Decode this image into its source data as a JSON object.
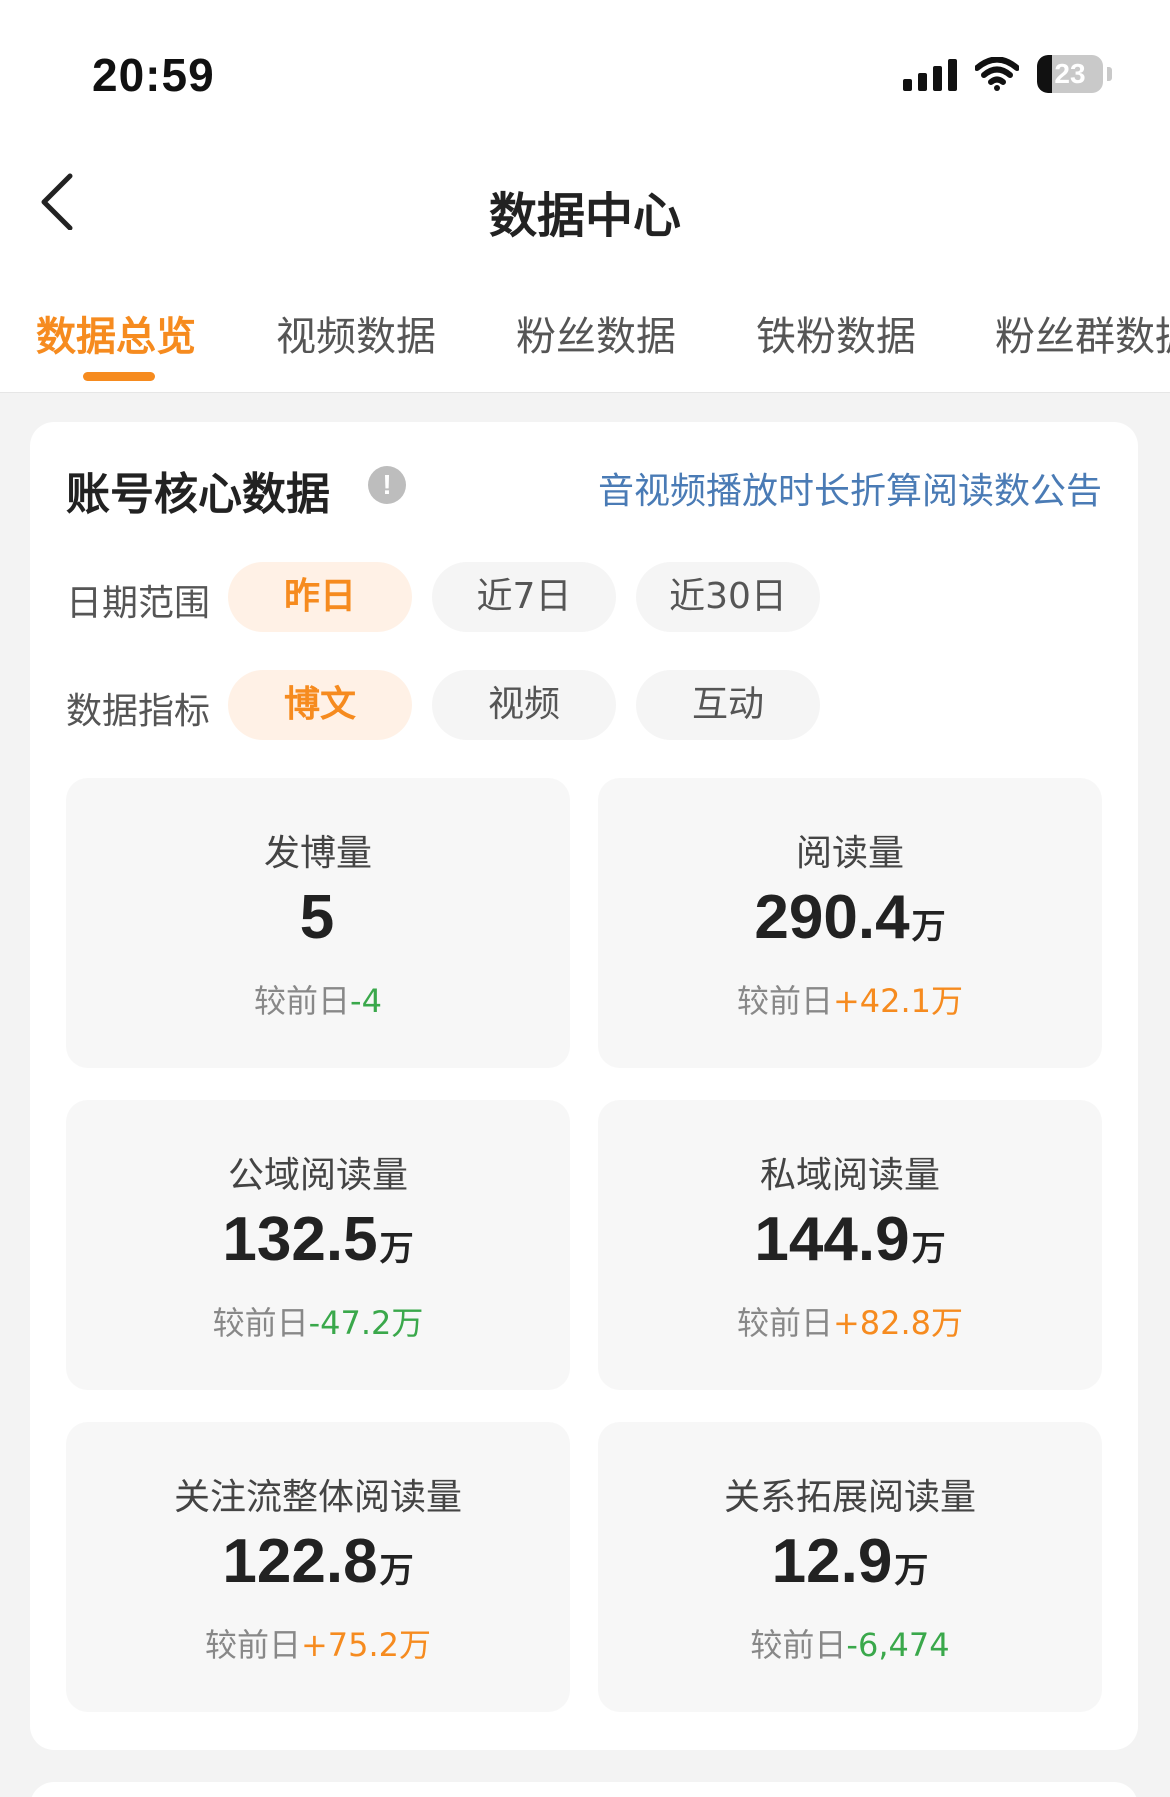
{
  "status_bar": {
    "time": "20:59",
    "battery_level": "23",
    "icons": [
      "signal-icon",
      "wifi-icon",
      "battery-icon"
    ]
  },
  "header": {
    "title": "数据中心",
    "back_icon": "chevron-left-icon"
  },
  "tabs": [
    {
      "label": "数据总览",
      "active": true
    },
    {
      "label": "视频数据",
      "active": false
    },
    {
      "label": "粉丝数据",
      "active": false
    },
    {
      "label": "铁粉数据",
      "active": false
    },
    {
      "label": "粉丝群数据",
      "active": false
    }
  ],
  "core": {
    "title": "账号核心数据",
    "info_icon": "info-icon",
    "notice_link": "音视频播放时长折算阅读数公告",
    "date_range": {
      "label": "日期范围",
      "options": [
        {
          "label": "昨日",
          "active": true
        },
        {
          "label": "近7日",
          "active": false
        },
        {
          "label": "近30日",
          "active": false
        }
      ]
    },
    "metric_type": {
      "label": "数据指标",
      "options": [
        {
          "label": "博文",
          "active": true
        },
        {
          "label": "视频",
          "active": false
        },
        {
          "label": "互动",
          "active": false
        }
      ]
    },
    "compare_prefix": "较前日",
    "metrics": [
      {
        "label": "发博量",
        "value": "5",
        "unit": "",
        "delta": "-4",
        "trend": "down"
      },
      {
        "label": "阅读量",
        "value": "290.4",
        "unit": "万",
        "delta": "+42.1万",
        "trend": "up"
      },
      {
        "label": "公域阅读量",
        "value": "132.5",
        "unit": "万",
        "delta": "-47.2万",
        "trend": "down"
      },
      {
        "label": "私域阅读量",
        "value": "144.9",
        "unit": "万",
        "delta": "+82.8万",
        "trend": "up"
      },
      {
        "label": "关注流整体阅读量",
        "value": "122.8",
        "unit": "万",
        "delta": "+75.2万",
        "trend": "up"
      },
      {
        "label": "关系拓展阅读量",
        "value": "12.9",
        "unit": "万",
        "delta": "-6,474",
        "trend": "down"
      }
    ]
  },
  "colors": {
    "accent": "#f68b1f",
    "up": "#f68b1f",
    "down": "#3aa84b",
    "link": "#4a7bb5"
  }
}
